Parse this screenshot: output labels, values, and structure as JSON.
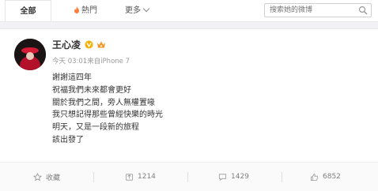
{
  "tabs": [
    {
      "label": "全部",
      "icon": "fire-icon"
    },
    {
      "label": "熱門",
      "icon": "fire-icon"
    },
    {
      "label": "更多",
      "icon": "chevron-down-icon"
    }
  ],
  "search": {
    "placeholder": "搜索她的微博",
    "icon": "search-icon"
  },
  "post": {
    "username": "王心凌",
    "badges": [
      "verified-v-icon",
      "vip-crown-icon"
    ],
    "meta": "今天 03:01来自iPhone 7",
    "lines": [
      "謝謝這四年",
      "祝福我們未來都會更好",
      "關於我們之間，旁人無權置喙",
      "我只想記得那些曾經快樂的時光",
      "明天，又是一段新的旅程",
      "該出發了"
    ]
  },
  "actions": {
    "favorite": "收藏",
    "repost": "1214",
    "comment": "1429",
    "like": "6852"
  },
  "colors": {
    "accent_orange": "#fa7d3c",
    "verified_gold": "#f6b200",
    "text_gray": "#808080"
  }
}
